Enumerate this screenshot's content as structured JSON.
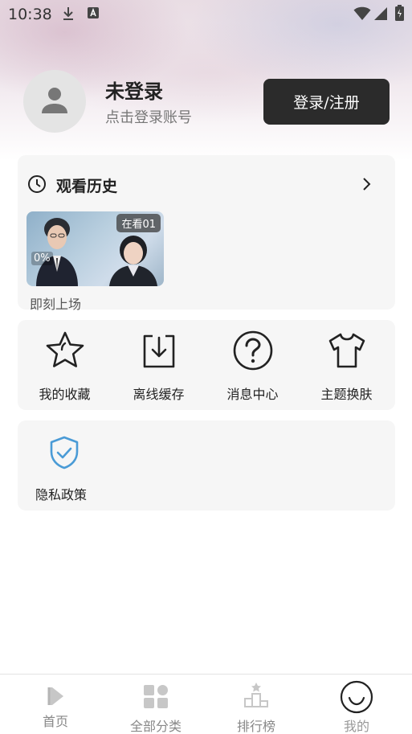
{
  "status_bar": {
    "time": "10:38"
  },
  "profile": {
    "title": "未登录",
    "subtitle": "点击登录账号",
    "login_button": "登录/注册"
  },
  "history": {
    "title": "观看历史",
    "items": [
      {
        "badge": "在看01",
        "progress": "0%",
        "caption": "即刻上场"
      }
    ]
  },
  "actions": [
    {
      "label": "我的收藏",
      "icon": "star-icon"
    },
    {
      "label": "离线缓存",
      "icon": "download-icon"
    },
    {
      "label": "消息中心",
      "icon": "help-icon"
    },
    {
      "label": "主题换肤",
      "icon": "shirt-icon"
    }
  ],
  "privacy": {
    "label": "隐私政策",
    "icon": "shield-check-icon"
  },
  "bottom_nav": [
    {
      "label": "首页",
      "icon": "play-icon"
    },
    {
      "label": "全部分类",
      "icon": "grid-icon"
    },
    {
      "label": "排行榜",
      "icon": "ranking-icon"
    },
    {
      "label": "我的",
      "icon": "smile-icon",
      "active": true
    }
  ]
}
